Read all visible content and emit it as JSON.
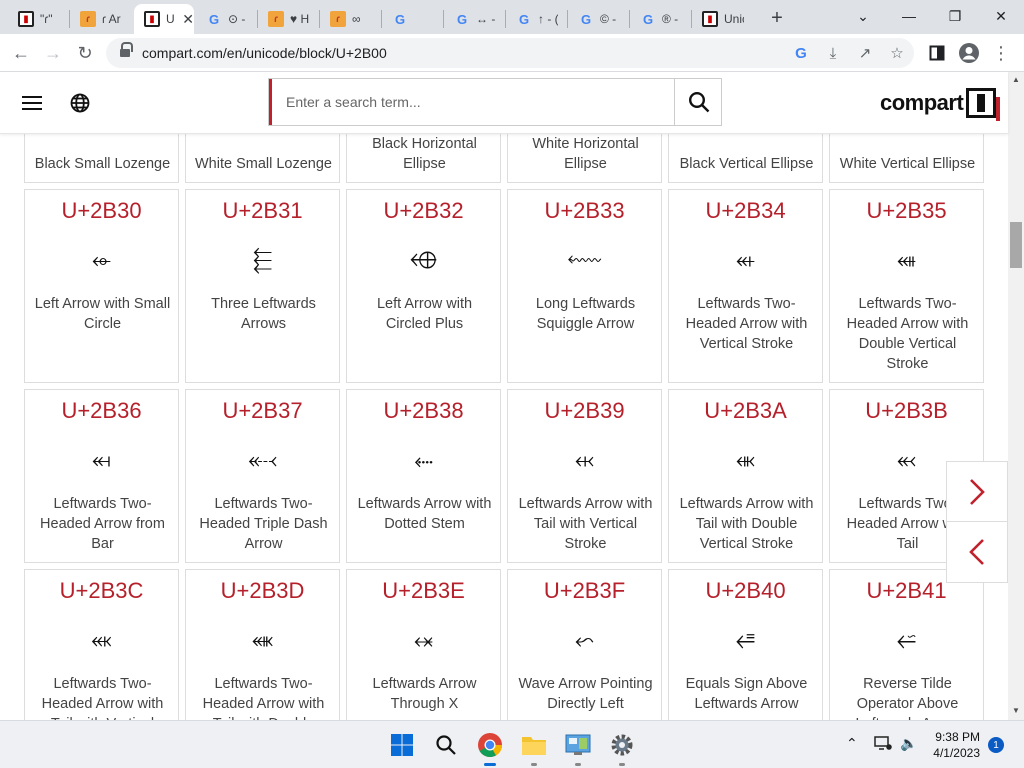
{
  "browser": {
    "tabs": [
      {
        "title": "\"ɾ\"",
        "icon": "compart-favicon",
        "active": false
      },
      {
        "title": "ɾ Ar",
        "icon": "orange-favicon",
        "active": false
      },
      {
        "title": "U",
        "icon": "compart-favicon",
        "active": true
      },
      {
        "title": "⊙ -",
        "icon": "google-favicon",
        "active": false
      },
      {
        "title": "♥ H",
        "icon": "orange-favicon",
        "active": false
      },
      {
        "title": "∞",
        "icon": "orange-favicon",
        "active": false
      },
      {
        "title": "",
        "icon": "google-favicon",
        "active": false
      },
      {
        "title": "↔ -",
        "icon": "google-favicon",
        "active": false
      },
      {
        "title": "↑ - (",
        "icon": "google-favicon",
        "active": false
      },
      {
        "title": "© -",
        "icon": "google-favicon",
        "active": false
      },
      {
        "title": "® -",
        "icon": "google-favicon",
        "active": false
      },
      {
        "title": "Unic",
        "icon": "compart-favicon",
        "active": false
      }
    ],
    "url": "compart.com/en/unicode/block/U+2B00"
  },
  "site": {
    "search_placeholder": "Enter a search term...",
    "logo_text": "compart"
  },
  "top_row_names": [
    "Black Small Lozenge",
    "White Small Lozenge",
    "Black Horizontal Ellipse",
    "White Horizontal Ellipse",
    "Black Vertical Ellipse",
    "White Vertical Ellipse"
  ],
  "rows": [
    [
      {
        "code": "U+2B30",
        "glyph": "⬰",
        "name": "Left Arrow with Small Circle"
      },
      {
        "code": "U+2B31",
        "glyph": "⬱",
        "name": "Three Leftwards Arrows"
      },
      {
        "code": "U+2B32",
        "glyph": "⬲",
        "name": "Left Arrow with Circled Plus"
      },
      {
        "code": "U+2B33",
        "glyph": "⬳",
        "name": "Long Leftwards Squiggle Arrow"
      },
      {
        "code": "U+2B34",
        "glyph": "⬴",
        "name": "Leftwards Two-Headed Arrow with Vertical Stroke"
      },
      {
        "code": "U+2B35",
        "glyph": "⬵",
        "name": "Leftwards Two-Headed Arrow with Double Vertical Stroke"
      }
    ],
    [
      {
        "code": "U+2B36",
        "glyph": "⬶",
        "name": "Leftwards Two-Headed Arrow from Bar"
      },
      {
        "code": "U+2B37",
        "glyph": "⬷",
        "name": "Leftwards Two-Headed Triple Dash Arrow"
      },
      {
        "code": "U+2B38",
        "glyph": "⬸",
        "name": "Leftwards Arrow with Dotted Stem"
      },
      {
        "code": "U+2B39",
        "glyph": "⬹",
        "name": "Leftwards Arrow with Tail with Vertical Stroke"
      },
      {
        "code": "U+2B3A",
        "glyph": "⬺",
        "name": "Leftwards Arrow with Tail with Double Vertical Stroke"
      },
      {
        "code": "U+2B3B",
        "glyph": "⬻",
        "name": "Leftwards Two-Headed Arrow with Tail"
      }
    ],
    [
      {
        "code": "U+2B3C",
        "glyph": "⬼",
        "name": "Leftwards Two-Headed Arrow with Tail with Vertical Stroke"
      },
      {
        "code": "U+2B3D",
        "glyph": "⬽",
        "name": "Leftwards Two-Headed Arrow with Tail with Double Vertical Stroke"
      },
      {
        "code": "U+2B3E",
        "glyph": "⬾",
        "name": "Leftwards Arrow Through X"
      },
      {
        "code": "U+2B3F",
        "glyph": "⬿",
        "name": "Wave Arrow Pointing Directly Left"
      },
      {
        "code": "U+2B40",
        "glyph": "⭀",
        "name": "Equals Sign Above Leftwards Arrow"
      },
      {
        "code": "U+2B41",
        "glyph": "⭁",
        "name": "Reverse Tilde Operator Above Leftwards Arrow"
      }
    ]
  ],
  "taskbar": {
    "time": "9:38 PM",
    "date": "4/1/2023",
    "notification_count": "1"
  },
  "colors": {
    "accent_red": "#b5202b",
    "chrome_frame": "#dee1e6"
  }
}
